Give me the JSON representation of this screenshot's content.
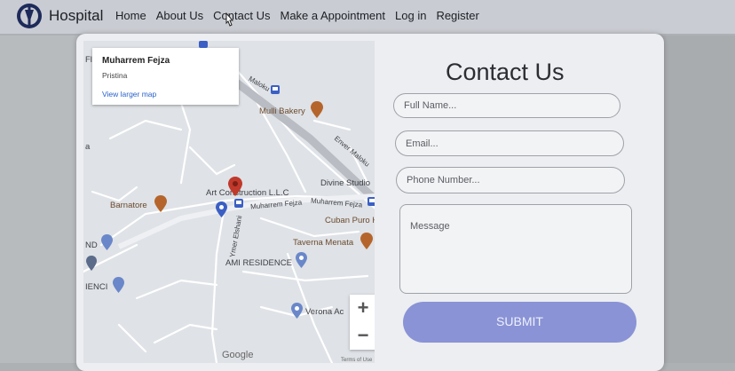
{
  "brand": {
    "name": "Hospital"
  },
  "nav": {
    "items": [
      {
        "label": "Home"
      },
      {
        "label": "About Us"
      },
      {
        "label": "Contact Us"
      },
      {
        "label": "Make a Appointment"
      },
      {
        "label": "Log in"
      },
      {
        "label": "Register"
      }
    ]
  },
  "map": {
    "info": {
      "title": "Muharrem Fejza",
      "subtitle": "Pristina",
      "link": "View larger map"
    },
    "labels": {
      "maloku_top": "Maloku",
      "mulli_bakery": "Mulli Bakery",
      "enver_maloku": "Enver Maloku",
      "divine_studio": "Divine Studio",
      "art_construction": "Art Construction L.L.C",
      "barnatore": "Barnatore",
      "muharrem_fejza_street": "Muharrem Fejza",
      "muharrem_fejza_street2": "Muharrem Fejza",
      "cuban_puro": "Cuban Puro H",
      "ymer_elshani": "Ymer Elshani",
      "taverna_menata": "Taverna Menata",
      "ami_residence": "AMI RESIDENCE",
      "verona": "Verona Ac",
      "left_fl": "Fl",
      "left_a": "a",
      "left_nd": "ND",
      "left_ienci": "IENCI",
      "google": "Google",
      "terms": "Terms of Use"
    },
    "zoom_in": "+",
    "zoom_out": "−"
  },
  "contact": {
    "title": "Contact Us",
    "full_name_placeholder": "Full Name...",
    "email_placeholder": "Email...",
    "phone_placeholder": "Phone Number...",
    "message_placeholder": "Message",
    "submit_label": "SUBMIT"
  },
  "colors": {
    "accent": "#8a93d6",
    "navbar": "#c9ccd2",
    "map_pin_red": "#c0392b",
    "map_pin_blue": "#3b5fc4",
    "link_blue": "#2a62c9"
  },
  "icons": [
    "hospital-logo-icon",
    "cursor-icon",
    "map-pin-icon",
    "restaurant-icon",
    "bus-stop-icon",
    "zoom-plus-icon",
    "zoom-minus-icon"
  ]
}
